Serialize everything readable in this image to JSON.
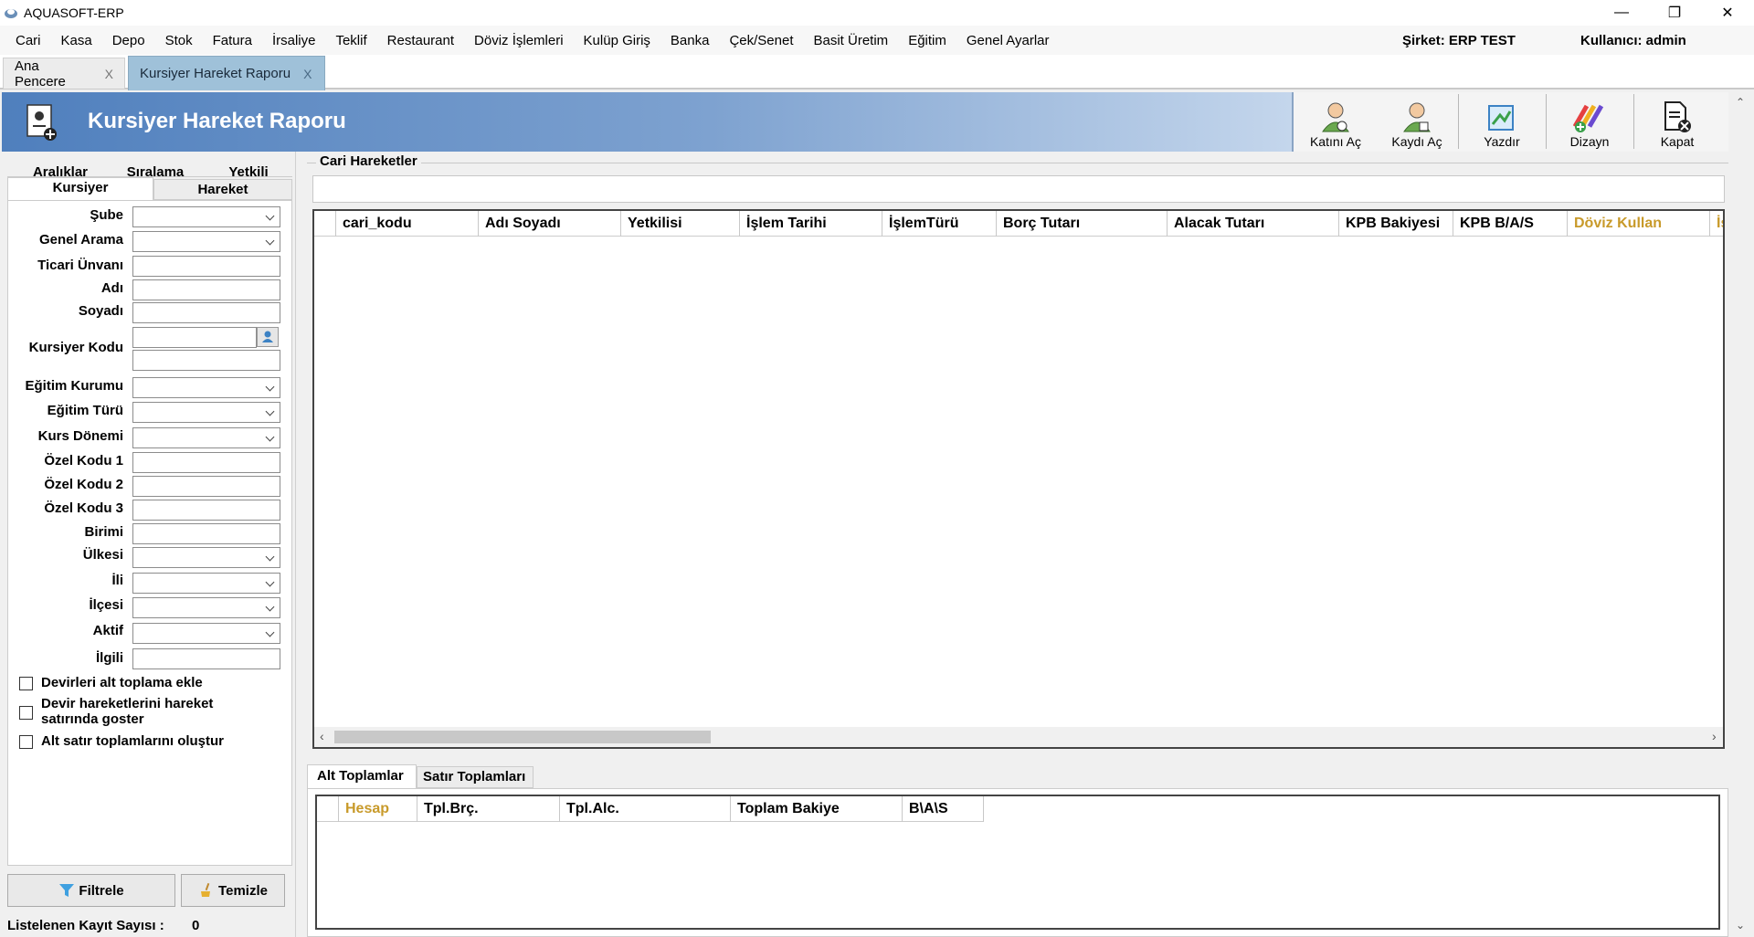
{
  "window": {
    "title": "AQUASOFT-ERP",
    "controls": {
      "minimize": "—",
      "restore": "❐",
      "close": "✕"
    }
  },
  "menu": {
    "items": [
      "Cari",
      "Kasa",
      "Depo",
      "Stok",
      "Fatura",
      "İrsaliye",
      "Teklif",
      "Restaurant",
      "Döviz İşlemleri",
      "Kulüp Giriş",
      "Banka",
      "Çek/Senet",
      "Basit Üretim",
      "Eğitim",
      "Genel Ayarlar"
    ],
    "company": "Şirket: ERP TEST",
    "user": "Kullanıcı: admin"
  },
  "doc_tabs": [
    {
      "label": "Ana Pencere",
      "close": "X"
    },
    {
      "label": "Kursiyer Hareket Raporu",
      "close": "X"
    }
  ],
  "header": {
    "title": "Kursiyer Hareket Raporu"
  },
  "toolbar": {
    "buttons": [
      {
        "label": "Katını Aç",
        "icon": "user-open-icon"
      },
      {
        "label": "Kaydı Aç",
        "icon": "user-record-icon"
      },
      {
        "label": "Yazdır",
        "icon": "print-icon"
      },
      {
        "label": "Dizayn",
        "icon": "design-icon"
      },
      {
        "label": "Kapat",
        "icon": "close-doc-icon"
      }
    ]
  },
  "left_tabs": {
    "row1": [
      "Aralıklar",
      "Sıralama",
      "Yetkili"
    ],
    "row2": [
      "Kursiyer",
      "Hareket"
    ]
  },
  "form": {
    "fields": [
      {
        "label": "Şube",
        "value": ""
      },
      {
        "label": "Genel Arama",
        "value": ""
      },
      {
        "label": "Ticari Ünvanı",
        "value": ""
      },
      {
        "label": "Adı",
        "value": ""
      },
      {
        "label": "Soyadı",
        "value": ""
      },
      {
        "label": "Kursiyer Kodu",
        "value": ""
      },
      {
        "label": "Eğitim Kurumu",
        "value": ""
      },
      {
        "label": "Eğitim Türü",
        "value": ""
      },
      {
        "label": "Kurs Dönemi",
        "value": ""
      },
      {
        "label": "Özel Kodu 1",
        "value": ""
      },
      {
        "label": "Özel Kodu 2",
        "value": ""
      },
      {
        "label": "Özel Kodu 3",
        "value": ""
      },
      {
        "label": "Birimi",
        "value": ""
      },
      {
        "label": "Ülkesi",
        "value": ""
      },
      {
        "label": "İli",
        "value": ""
      },
      {
        "label": "İlçesi",
        "value": ""
      },
      {
        "label": "Aktif",
        "value": ""
      },
      {
        "label": "İlgili",
        "value": ""
      }
    ],
    "checkboxes": [
      {
        "label": "Devirleri alt toplama ekle",
        "checked": false
      },
      {
        "label": "Devir hareketlerini hareket satırında goster",
        "checked": false
      },
      {
        "label": "Alt satır toplamlarını oluştur",
        "checked": false
      }
    ]
  },
  "buttons": {
    "filter": "Filtrele",
    "clear": "Temizle"
  },
  "status": {
    "count_label": "Listelenen Kayıt Sayısı :",
    "count_value": "0"
  },
  "main": {
    "group_title": "Cari Hareketler",
    "columns": [
      "cari_kodu",
      "Adı Soyadı",
      "Yetkilisi",
      "İşlem Tarihi",
      "İşlemTürü",
      "Borç Tutarı",
      "Alacak Tutarı",
      "KPB Bakiyesi",
      "KPB B/A/S",
      "Döviz Kullan",
      "İş"
    ],
    "rows": []
  },
  "bottom": {
    "tabs": [
      "Alt Toplamlar",
      "Satır Toplamları"
    ],
    "columns": [
      "Hesap",
      "Tpl.Brç.",
      "Tpl.Alc.",
      "Toplam Bakiye",
      "B\\A\\S"
    ]
  },
  "colors": {
    "header_start": "#4f7fbd",
    "active_tab": "#9fc1d9",
    "gold_column": "#c89a2a"
  }
}
